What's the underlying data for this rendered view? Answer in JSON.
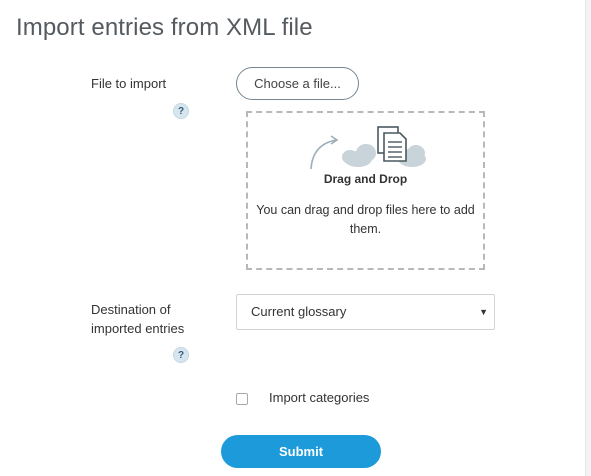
{
  "page": {
    "title": "Import entries from XML file"
  },
  "form": {
    "file_label": "File to import",
    "help_mark": "?",
    "choose_button": "Choose a file...",
    "dropzone": {
      "title": "Drag and Drop",
      "text": "You can drag and drop files here to add them."
    },
    "destination_label_line1": "Destination of",
    "destination_label_line2": "imported entries",
    "destination_selected": "Current glossary",
    "import_categories_label": "Import categories",
    "import_categories_checked": false,
    "submit_label": "Submit"
  },
  "colors": {
    "accent": "#1d9ad9",
    "help_bg": "#d7e6ee",
    "dashed_border": "#b8b8b8",
    "cloud": "#c9d3da"
  },
  "icons": {
    "dropzone": "file-upload-cloud-icon",
    "help": "help-icon",
    "select_arrow": "caret-down-icon"
  }
}
